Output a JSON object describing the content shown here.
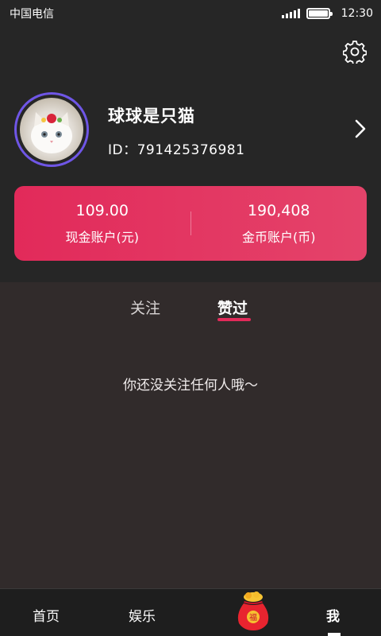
{
  "status_bar": {
    "carrier": "中国电信",
    "time": "12:30",
    "battery_level": 1.0
  },
  "profile": {
    "name": "球球是只猫",
    "id_text": "ID：791425376981"
  },
  "wallet": {
    "cash_value": "109.00",
    "cash_label": "现金账户(元)",
    "coin_value": "190,408",
    "coin_label": "金币账户(币)"
  },
  "tabs": [
    {
      "label": "关注",
      "active": false
    },
    {
      "label": "赞过",
      "active": true
    }
  ],
  "empty_message": "你还没关注任何人哦～",
  "bottom_nav": [
    {
      "label": "首页",
      "active": false
    },
    {
      "label": "娱乐",
      "active": false
    },
    {
      "label": "我",
      "active": true
    }
  ],
  "colors": {
    "accent": "#e22a5a",
    "avatar_ring": "#6f56e6",
    "top_background": "#262626",
    "content_background": "#312b2b"
  },
  "icons": {
    "settings": "gear-icon",
    "chevron": "chevron-right-icon",
    "center_nav": "red-lucky-bag-icon"
  }
}
